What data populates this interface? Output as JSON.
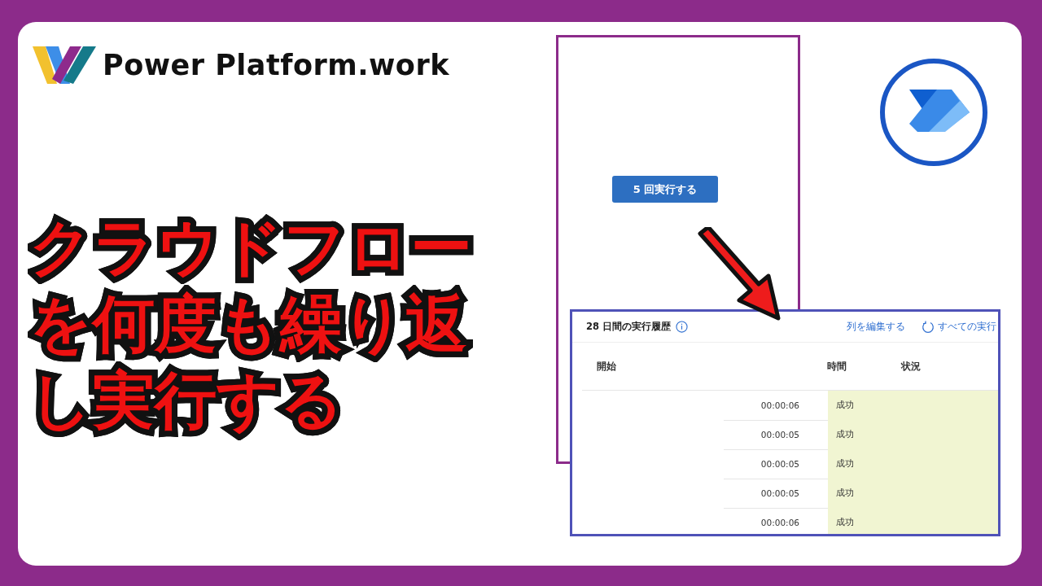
{
  "brand": {
    "name": "Power Platform.work"
  },
  "headline": {
    "lines": [
      "クラウドフロー",
      "を何度も繰り返",
      "し実行する"
    ]
  },
  "app_panel": {
    "button": "5 回実行する"
  },
  "run_history": {
    "title": "28 日間の実行履歴",
    "actions": [
      {
        "kind": "link",
        "label": "列を編集する"
      },
      {
        "kind": "refresh",
        "label": "すべての実行"
      }
    ],
    "columns": [
      "開始",
      "時間",
      "状況"
    ],
    "rows": [
      {
        "duration": "00:00:06",
        "status": "成功"
      },
      {
        "duration": "00:00:05",
        "status": "成功"
      },
      {
        "duration": "00:00:05",
        "status": "成功"
      },
      {
        "duration": "00:00:05",
        "status": "成功"
      },
      {
        "duration": "00:00:06",
        "status": "成功"
      }
    ]
  }
}
